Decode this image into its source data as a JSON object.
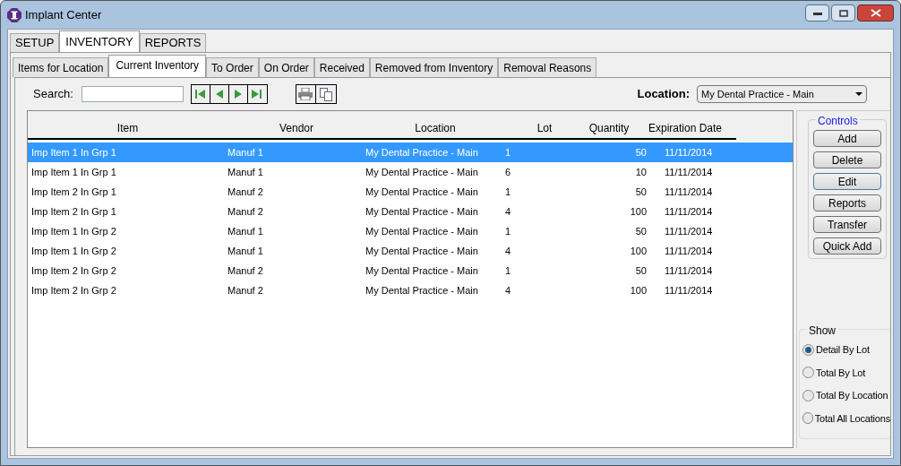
{
  "window": {
    "title": "Implant Center"
  },
  "tabs": [
    {
      "label": "SETUP",
      "selected": false
    },
    {
      "label": "INVENTORY",
      "selected": true
    },
    {
      "label": "REPORTS",
      "selected": false
    }
  ],
  "subtabs": [
    {
      "label": "Items for Location",
      "selected": false
    },
    {
      "label": "Current Inventory",
      "selected": true
    },
    {
      "label": "To Order",
      "selected": false
    },
    {
      "label": "On Order",
      "selected": false
    },
    {
      "label": "Received",
      "selected": false
    },
    {
      "label": "Removed from Inventory",
      "selected": false
    },
    {
      "label": "Removal Reasons",
      "selected": false
    }
  ],
  "search": {
    "label": "Search:"
  },
  "location": {
    "label": "Location:",
    "value": "My Dental Practice - Main"
  },
  "table": {
    "columns": [
      "Item",
      "Vendor",
      "Location",
      "Lot",
      "Quantity",
      "Expiration Date"
    ],
    "rows": [
      {
        "cells": [
          "Imp Item 1 In Grp 1",
          "Manuf 1",
          "My Dental Practice - Main",
          "1",
          "50",
          "11/11/2014"
        ],
        "selected": true
      },
      {
        "cells": [
          "Imp Item 1 In Grp 1",
          "Manuf 1",
          "My Dental Practice - Main",
          "6",
          "10",
          "11/11/2014"
        ],
        "selected": false
      },
      {
        "cells": [
          "Imp Item 2 In Grp 1",
          "Manuf 2",
          "My Dental Practice - Main",
          "1",
          "50",
          "11/11/2014"
        ],
        "selected": false
      },
      {
        "cells": [
          "Imp Item 2 In Grp 1",
          "Manuf 2",
          "My Dental Practice - Main",
          "4",
          "100",
          "11/11/2014"
        ],
        "selected": false
      },
      {
        "cells": [
          "Imp Item 1 In Grp 2",
          "Manuf 1",
          "My Dental Practice - Main",
          "1",
          "50",
          "11/11/2014"
        ],
        "selected": false
      },
      {
        "cells": [
          "Imp Item 1 In Grp 2",
          "Manuf 1",
          "My Dental Practice - Main",
          "4",
          "100",
          "11/11/2014"
        ],
        "selected": false
      },
      {
        "cells": [
          "Imp Item 2 In Grp 2",
          "Manuf 2",
          "My Dental Practice - Main",
          "1",
          "50",
          "11/11/2014"
        ],
        "selected": false
      },
      {
        "cells": [
          "Imp Item 2 In Grp 2",
          "Manuf 2",
          "My Dental Practice - Main",
          "4",
          "100",
          "11/11/2014"
        ],
        "selected": false
      }
    ]
  },
  "controls": {
    "title": "Controls",
    "buttons": [
      {
        "label": "Add",
        "focused": false
      },
      {
        "label": "Delete",
        "focused": false
      },
      {
        "label": "Edit",
        "focused": true
      },
      {
        "label": "Reports",
        "focused": false
      },
      {
        "label": "Transfer",
        "focused": false
      },
      {
        "label": "Quick Add",
        "focused": false
      }
    ]
  },
  "show": {
    "title": "Show",
    "options": [
      {
        "label": "Detail By Lot",
        "selected": true
      },
      {
        "label": "Total By Lot",
        "selected": false
      },
      {
        "label": "Total By Location",
        "selected": false
      },
      {
        "label": "Total All Locations",
        "selected": false
      }
    ]
  }
}
